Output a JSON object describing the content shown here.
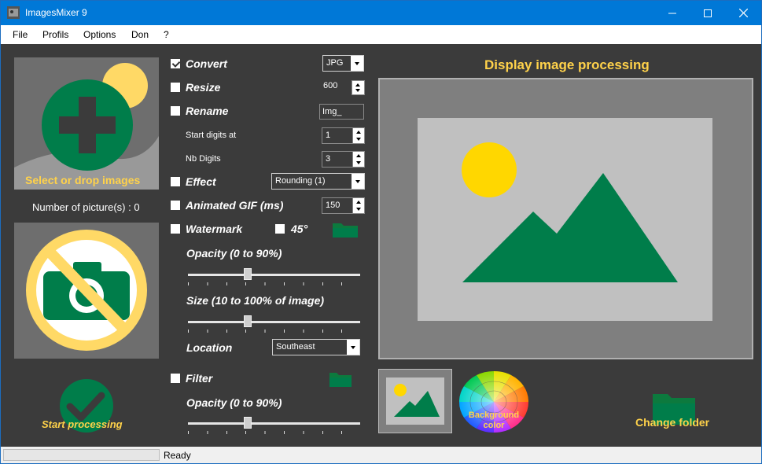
{
  "window": {
    "title": "ImagesMixer 9"
  },
  "menu": [
    "File",
    "Profils",
    "Options",
    "Don",
    "?"
  ],
  "left": {
    "select_label": "Select or drop images",
    "count_label": "Number of picture(s) : 0",
    "start_label": "Start processing"
  },
  "options": {
    "convert": {
      "label": "Convert",
      "checked": true,
      "value": "JPG"
    },
    "resize": {
      "label": "Resize",
      "checked": false,
      "value": "600"
    },
    "rename": {
      "label": "Rename",
      "checked": false,
      "value": "Img_"
    },
    "start_digits": {
      "label": "Start digits at",
      "value": "1"
    },
    "nb_digits": {
      "label": "Nb Digits",
      "value": "3"
    },
    "effect": {
      "label": "Effect",
      "checked": false,
      "value": "Rounding (1)"
    },
    "gif": {
      "label": "Animated GIF (ms)",
      "checked": false,
      "value": "150"
    },
    "watermark": {
      "label": "Watermark",
      "checked": false,
      "angle_label": "45°",
      "angle_checked": false
    },
    "opacity1": {
      "label": "Opacity (0 to 90%)",
      "level": 0.34
    },
    "size": {
      "label": "Size (10 to 100% of image)",
      "level": 0.34
    },
    "location": {
      "label": "Location",
      "value": "Southeast"
    },
    "filter": {
      "label": "Filter",
      "checked": false
    },
    "opacity2": {
      "label": "Opacity (0 to 90%)",
      "level": 0.34
    }
  },
  "right": {
    "title": "Display image processing",
    "bg_label_1": "Background",
    "bg_label_2": "color",
    "change_folder": "Change folder"
  },
  "status": {
    "text": "Ready"
  },
  "colors": {
    "accent": "#ffd24a",
    "green": "#007d4a",
    "titlebar": "#0078d7"
  }
}
